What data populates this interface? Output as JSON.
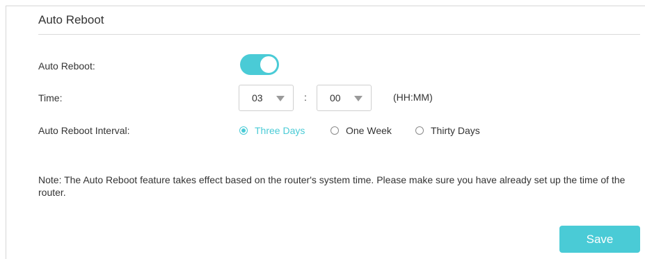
{
  "section": {
    "title": "Auto Reboot"
  },
  "colors": {
    "accent": "#4acbd6"
  },
  "auto_reboot": {
    "label": "Auto Reboot:",
    "enabled": true
  },
  "time": {
    "label": "Time:",
    "hour": "03",
    "minute": "00",
    "separator": ":",
    "format_hint": "(HH:MM)"
  },
  "interval": {
    "label": "Auto Reboot Interval:",
    "options": [
      {
        "label": "Three Days",
        "checked": true
      },
      {
        "label": "One Week",
        "checked": false
      },
      {
        "label": "Thirty Days",
        "checked": false
      }
    ]
  },
  "note": "Note: The Auto Reboot feature takes effect based on the router's system time. Please make sure you have already set up the time of the router.",
  "save_label": "Save"
}
